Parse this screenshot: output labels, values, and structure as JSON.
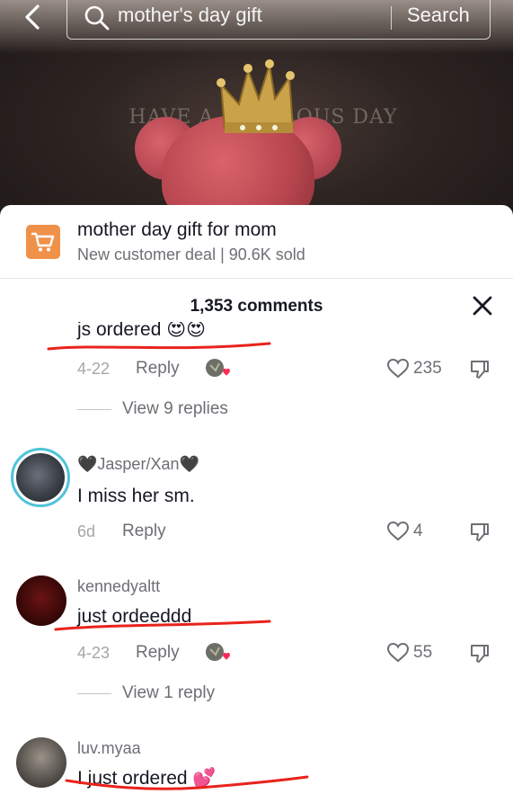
{
  "search": {
    "query": "mother's day gift",
    "button_label": "Search"
  },
  "video": {
    "book_text": "HAVE A FABULOUS DAY"
  },
  "product": {
    "title": "mother day gift for mom",
    "subtitle": "New customer deal | 90.6K sold",
    "icon": "shopping-cart-icon",
    "icon_color": "#f0914a"
  },
  "comments_header": {
    "count_label": "1,353 comments"
  },
  "comments": [
    {
      "text": "js ordered 😍😍",
      "date": "4-22",
      "reply_label": "Reply",
      "likes": "235",
      "view_replies": "View 9 replies"
    },
    {
      "user": "🖤Jasper/Xan🖤",
      "text": "I miss her sm.",
      "date": "6d",
      "reply_label": "Reply",
      "likes": "4"
    },
    {
      "user": "kennedyaltt",
      "text": "just ordeeddd",
      "date": "4-23",
      "reply_label": "Reply",
      "likes": "55",
      "view_replies": "View 1 reply"
    },
    {
      "user": "luv.myaa",
      "text": "I just ordered 💕"
    }
  ],
  "colors": {
    "annotation_red": "#e8231c",
    "creator_heart": "#fe2c55",
    "avatar_ring": "#4fc3d9"
  }
}
